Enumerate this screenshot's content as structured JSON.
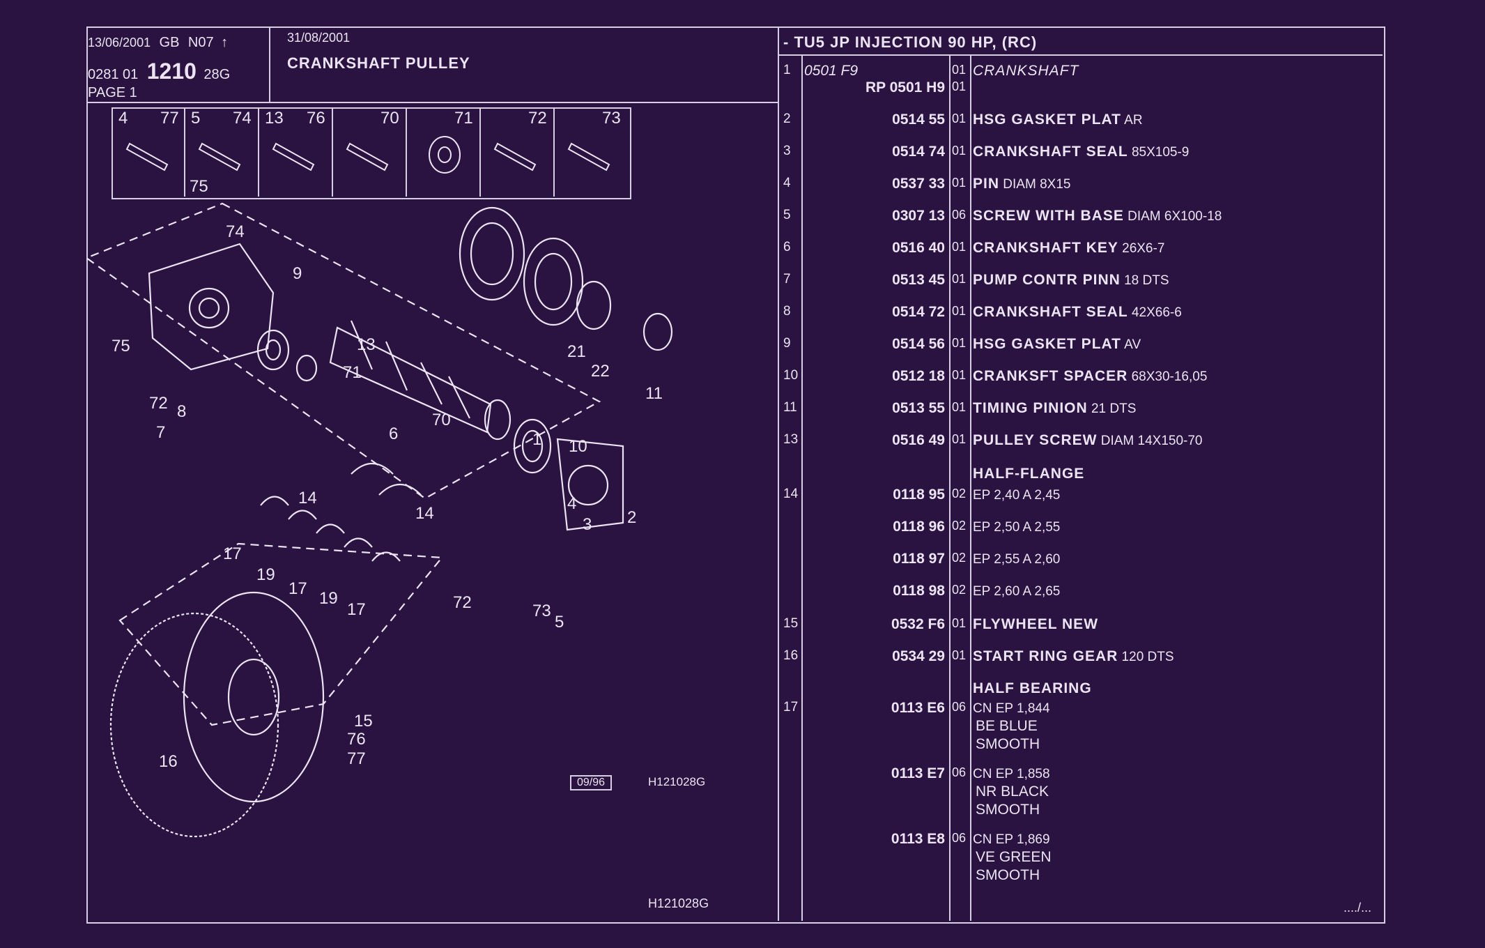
{
  "header": {
    "date1": "13/06/2001",
    "region": "GB",
    "code": "N07",
    "arrow": "↑",
    "ref_prefix": "0281 01",
    "ref_main": "1210",
    "ref_suffix": "28G",
    "page": "PAGE 1",
    "date2": "31/08/2001",
    "title": "CRANKSHAFT PULLEY",
    "model": "- TU5 JP INJECTION 90 HP, (RC)"
  },
  "hardware_cells": [
    {
      "left": "4",
      "right": "77",
      "extra": ""
    },
    {
      "left": "5",
      "right": "74",
      "extra": "75"
    },
    {
      "left": "13",
      "right": "76",
      "extra": ""
    },
    {
      "left": "",
      "right": "70",
      "extra": ""
    },
    {
      "left": "",
      "right": "71",
      "extra": ""
    },
    {
      "left": "",
      "right": "72",
      "extra": ""
    },
    {
      "left": "",
      "right": "73",
      "extra": ""
    }
  ],
  "callouts": [
    "74",
    "9",
    "75",
    "72",
    "8",
    "7",
    "13",
    "71",
    "70",
    "21",
    "22",
    "11",
    "10",
    "6",
    "1",
    "4",
    "3",
    "2",
    "14",
    "14",
    "17",
    "19",
    "17",
    "19",
    "17",
    "72",
    "73",
    "5",
    "15",
    "76",
    "77",
    "16"
  ],
  "footer": {
    "date_box": "09/96",
    "code": "H121028G",
    "code_bottom": "H121028G",
    "continued": "..../..."
  },
  "parts": [
    {
      "num": "1",
      "ref": "0501 F9",
      "qty": "01",
      "name": "CRANKSHAFT",
      "spec": "",
      "lines": [],
      "italic": true
    },
    {
      "num": "",
      "ref": "RP 0501 H9",
      "qty": "01",
      "name": "",
      "spec": "",
      "lines": []
    },
    {
      "num": "2",
      "ref": "0514 55",
      "qty": "01",
      "name": "HSG GASKET PLAT",
      "spec": "AR",
      "lines": []
    },
    {
      "num": "3",
      "ref": "0514 74",
      "qty": "01",
      "name": "CRANKSHAFT SEAL",
      "spec": "85X105-9",
      "lines": []
    },
    {
      "num": "4",
      "ref": "0537 33",
      "qty": "01",
      "name": "PIN",
      "spec": "DIAM 8X15",
      "lines": []
    },
    {
      "num": "5",
      "ref": "0307 13",
      "qty": "06",
      "name": "SCREW WITH BASE",
      "spec": "DIAM 6X100-18",
      "lines": []
    },
    {
      "num": "6",
      "ref": "0516 40",
      "qty": "01",
      "name": "CRANKSHAFT KEY",
      "spec": "26X6-7",
      "lines": []
    },
    {
      "num": "7",
      "ref": "0513 45",
      "qty": "01",
      "name": "PUMP CONTR PINN",
      "spec": "18 DTS",
      "lines": []
    },
    {
      "num": "8",
      "ref": "0514 72",
      "qty": "01",
      "name": "CRANKSHAFT SEAL",
      "spec": "42X66-6",
      "lines": []
    },
    {
      "num": "9",
      "ref": "0514 56",
      "qty": "01",
      "name": "HSG GASKET PLAT",
      "spec": "AV",
      "lines": []
    },
    {
      "num": "10",
      "ref": "0512 18",
      "qty": "01",
      "name": "CRANKSFT SPACER",
      "spec": "68X30-16,05",
      "lines": []
    },
    {
      "num": "11",
      "ref": "0513 55",
      "qty": "01",
      "name": "TIMING PINION",
      "spec": "21 DTS",
      "lines": []
    },
    {
      "num": "13",
      "ref": "0516 49",
      "qty": "01",
      "name": "PULLEY SCREW",
      "spec": "DIAM 14X150-70",
      "lines": []
    },
    {
      "num": "",
      "ref": "",
      "qty": "",
      "name": "HALF-FLANGE",
      "spec": "",
      "lines": []
    },
    {
      "num": "14",
      "ref": "0118 95",
      "qty": "02",
      "name": "",
      "spec": "EP 2,40 A 2,45",
      "lines": []
    },
    {
      "num": "",
      "ref": "0118 96",
      "qty": "02",
      "name": "",
      "spec": "EP 2,50 A 2,55",
      "lines": []
    },
    {
      "num": "",
      "ref": "0118 97",
      "qty": "02",
      "name": "",
      "spec": "EP 2,55 A 2,60",
      "lines": []
    },
    {
      "num": "",
      "ref": "0118 98",
      "qty": "02",
      "name": "",
      "spec": "EP 2,60 A 2,65",
      "lines": []
    },
    {
      "num": "15",
      "ref": "0532 F6",
      "qty": "01",
      "name": "FLYWHEEL NEW",
      "spec": "",
      "lines": []
    },
    {
      "num": "16",
      "ref": "0534 29",
      "qty": "01",
      "name": "START RING GEAR",
      "spec": "120 DTS",
      "lines": []
    },
    {
      "num": "",
      "ref": "",
      "qty": "",
      "name": "HALF BEARING",
      "spec": "",
      "lines": []
    },
    {
      "num": "17",
      "ref": "0113 E6",
      "qty": "06",
      "name": "",
      "spec": "CN EP 1,844",
      "lines": [
        "BE BLUE",
        "SMOOTH"
      ]
    },
    {
      "num": "",
      "ref": "0113 E7",
      "qty": "06",
      "name": "",
      "spec": "CN EP 1,858",
      "lines": [
        "NR BLACK",
        "SMOOTH"
      ]
    },
    {
      "num": "",
      "ref": "0113 E8",
      "qty": "06",
      "name": "",
      "spec": "CN EP 1,869",
      "lines": [
        "VE GREEN",
        "SMOOTH"
      ]
    }
  ]
}
